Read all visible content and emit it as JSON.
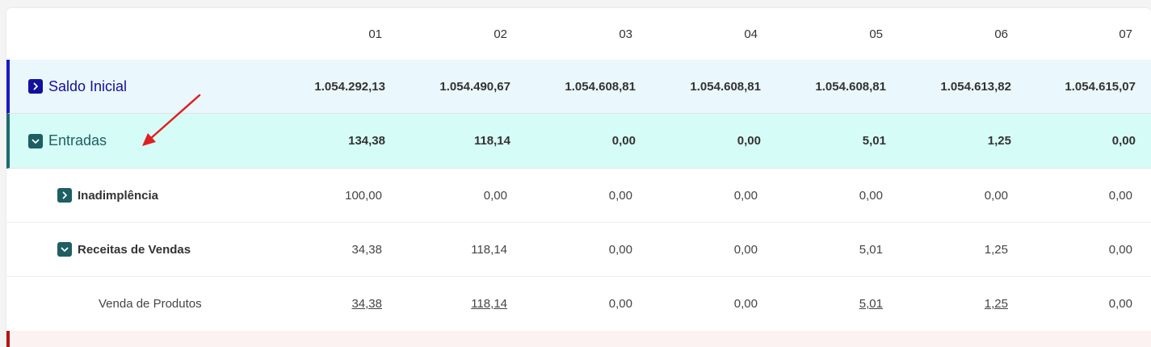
{
  "columns": [
    "01",
    "02",
    "03",
    "04",
    "05",
    "06",
    "07"
  ],
  "rows": {
    "saldo": {
      "label": "Saldo Inicial",
      "values": [
        "1.054.292,13",
        "1.054.490,67",
        "1.054.608,81",
        "1.054.608,81",
        "1.054.608,81",
        "1.054.613,82",
        "1.054.615,07"
      ]
    },
    "entradas": {
      "label": "Entradas",
      "values": [
        "134,38",
        "118,14",
        "0,00",
        "0,00",
        "5,01",
        "1,25",
        "0,00"
      ]
    },
    "inadimplencia": {
      "label": "Inadimplência",
      "values": [
        "100,00",
        "0,00",
        "0,00",
        "0,00",
        "0,00",
        "0,00",
        "0,00"
      ]
    },
    "receitas": {
      "label": "Receitas de Vendas",
      "values": [
        "34,38",
        "118,14",
        "0,00",
        "0,00",
        "5,01",
        "1,25",
        "0,00"
      ]
    },
    "venda": {
      "label": "Venda de Produtos",
      "values": [
        "34,38",
        "118,14",
        "0,00",
        "0,00",
        "5,01",
        "1,25",
        "0,00"
      ]
    }
  },
  "colors": {
    "saldo_accent": "#1a1ac8",
    "entradas_accent": "#1e6b6e",
    "saidas_accent": "#b01818",
    "annotation_arrow": "#e02020"
  },
  "icons": {
    "collapsed": "chevron-right-icon",
    "expanded": "chevron-down-icon"
  }
}
